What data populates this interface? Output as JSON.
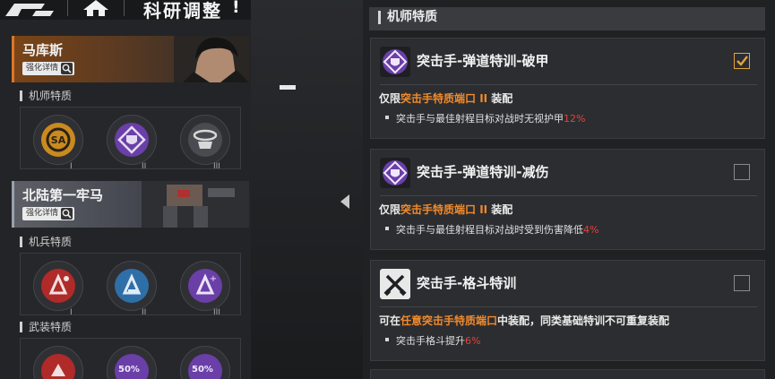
{
  "topbar": {
    "title": "科研调整",
    "mark": "!"
  },
  "left": {
    "pilot": {
      "name": "马库斯",
      "detail_button": "强化详情"
    },
    "pilot_section": "机师特质",
    "pilot_slots": [
      {
        "icon": "sa-crosshair-icon",
        "roman": "I",
        "color": "#c98a1f"
      },
      {
        "icon": "shield-diamond-icon",
        "roman": "II",
        "color": "#6a3fa8"
      },
      {
        "icon": "ring-figure-icon",
        "roman": "III",
        "color": "#4a4b50"
      }
    ],
    "mech": {
      "name": "北陆第一牢马",
      "detail_button": "强化详情"
    },
    "mech_section": "机兵特质",
    "mech_slots": [
      {
        "icon": "mech-red-icon",
        "roman": "I",
        "color": "#b02a2a"
      },
      {
        "icon": "mech-blue-icon",
        "roman": "II",
        "color": "#2f6fa8"
      },
      {
        "icon": "mech-purple-icon",
        "roman": "III",
        "color": "#6a3fa8"
      }
    ],
    "weapon_section": "武装特质",
    "weapon_slots": [
      {
        "icon": "weapon-red-icon",
        "label": "",
        "color": "#b02a2a"
      },
      {
        "icon": "percent-purple-icon",
        "label": "50%",
        "color": "#6a3fa8"
      },
      {
        "icon": "percent-purple-icon",
        "label": "50%",
        "color": "#6a3fa8"
      }
    ]
  },
  "right": {
    "header": "机师特质",
    "cards": [
      {
        "title": "突击手-弹道特训-破甲",
        "checked": true,
        "req_prefix": "仅限",
        "req_highlight": "突击手特质端口 II",
        "req_suffix": " 装配",
        "bullet_text": "突击手与最佳射程目标对战时无视护甲",
        "bullet_value": "12%",
        "icon": "ballistic-shield-icon"
      },
      {
        "title": "突击手-弹道特训-减伤",
        "checked": false,
        "req_prefix": "仅限",
        "req_highlight": "突击手特质端口 II",
        "req_suffix": " 装配",
        "bullet_text": "突击手与最佳射程目标对战时受到伤害降低",
        "bullet_value": "4%",
        "icon": "ballistic-shield-icon"
      },
      {
        "title": "突击手-格斗特训",
        "checked": false,
        "req_prefix": "可在",
        "req_highlight": "任意突击手特质端口",
        "req_suffix": "中装配，同类基础特训不可重复装配",
        "bullet_text": "突击手格斗提升",
        "bullet_value": "6%",
        "icon": "crossed-blades-icon"
      }
    ]
  },
  "colors": {
    "accent_orange": "#f08a2c",
    "accent_red": "#e8413e",
    "check_gold": "#e2a53a"
  }
}
